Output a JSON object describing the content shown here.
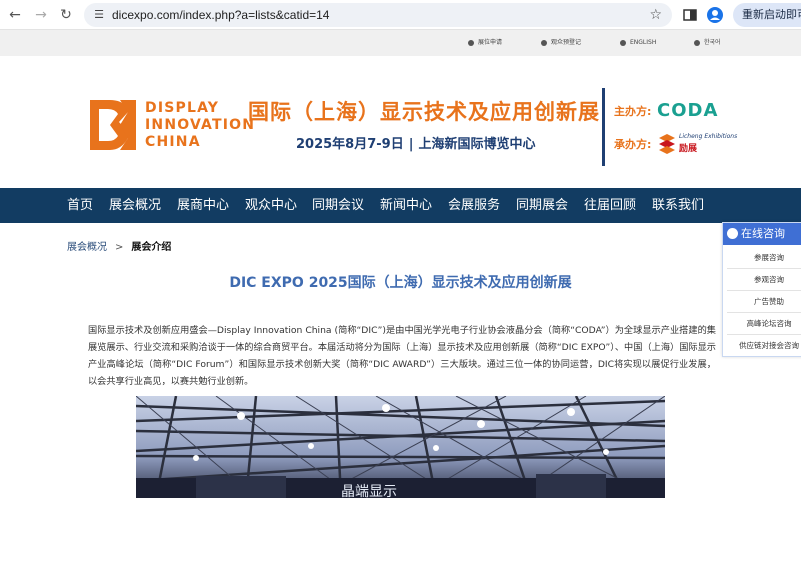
{
  "browser": {
    "url": "dicexpo.com/index.php?a=lists&catid=14",
    "restart_label": "重新启动即可更新"
  },
  "topbar": {
    "items": [
      "展位申请",
      "观众预登记",
      "ENGLISH",
      "한국어"
    ]
  },
  "header": {
    "logo_lines": [
      "DISPLAY",
      "INNOVATION",
      "CHINA"
    ],
    "main_title": "国际（上海）显示技术及应用创新展",
    "date": "2025年8月7-9日",
    "divider": "|",
    "venue": "上海新国际博览中心",
    "organizer_label": "主办方:",
    "organizer_name": "CODA",
    "undertaker_label": "承办方:",
    "undertaker_name_en": "Licheng Exhibitions",
    "undertaker_name_cn": "励展"
  },
  "nav": {
    "items": [
      "首页",
      "展会概况",
      "展商中心",
      "观众中心",
      "同期会议",
      "新闻中心",
      "会展服务",
      "同期展会",
      "往届回顾",
      "联系我们"
    ]
  },
  "breadcrumb": {
    "parent": "展会概况",
    "separator": ">",
    "current": "展会介绍"
  },
  "article": {
    "title": "DIC EXPO 2025国际（上海）显示技术及应用创新展",
    "body": "国际显示技术及创新应用盛会—Display Innovation China (简称“DIC”)是由中国光学光电子行业协会液晶分会（简称“CODA”）为全球显示产业搭建的集展览展示、行业交流和采购洽谈于一体的综合商贸平台。本届活动将分为国际（上海）显示技术及应用创新展（简称“DIC EXPO”）、中国（上海）国际显示产业高峰论坛（简称“DIC Forum”）和国际显示技术创新大奖（简称“DIC AWARD”）三大版块。通过三位一体的协同运营，DIC将实现以展促行业发展，以会共享行业高见，以赛共勉行业创新。"
  },
  "consult": {
    "title": "在线咨询",
    "items": [
      "参展咨询",
      "参观咨询",
      "广告赞助",
      "高峰论坛咨询",
      "供应链对接会咨询"
    ]
  },
  "colors": {
    "brand_orange": "#e8731c",
    "brand_navy": "#123c62",
    "title_blue": "#3f6bb0",
    "coda_teal": "#1aa091",
    "consult_blue": "#3f6fd4"
  }
}
